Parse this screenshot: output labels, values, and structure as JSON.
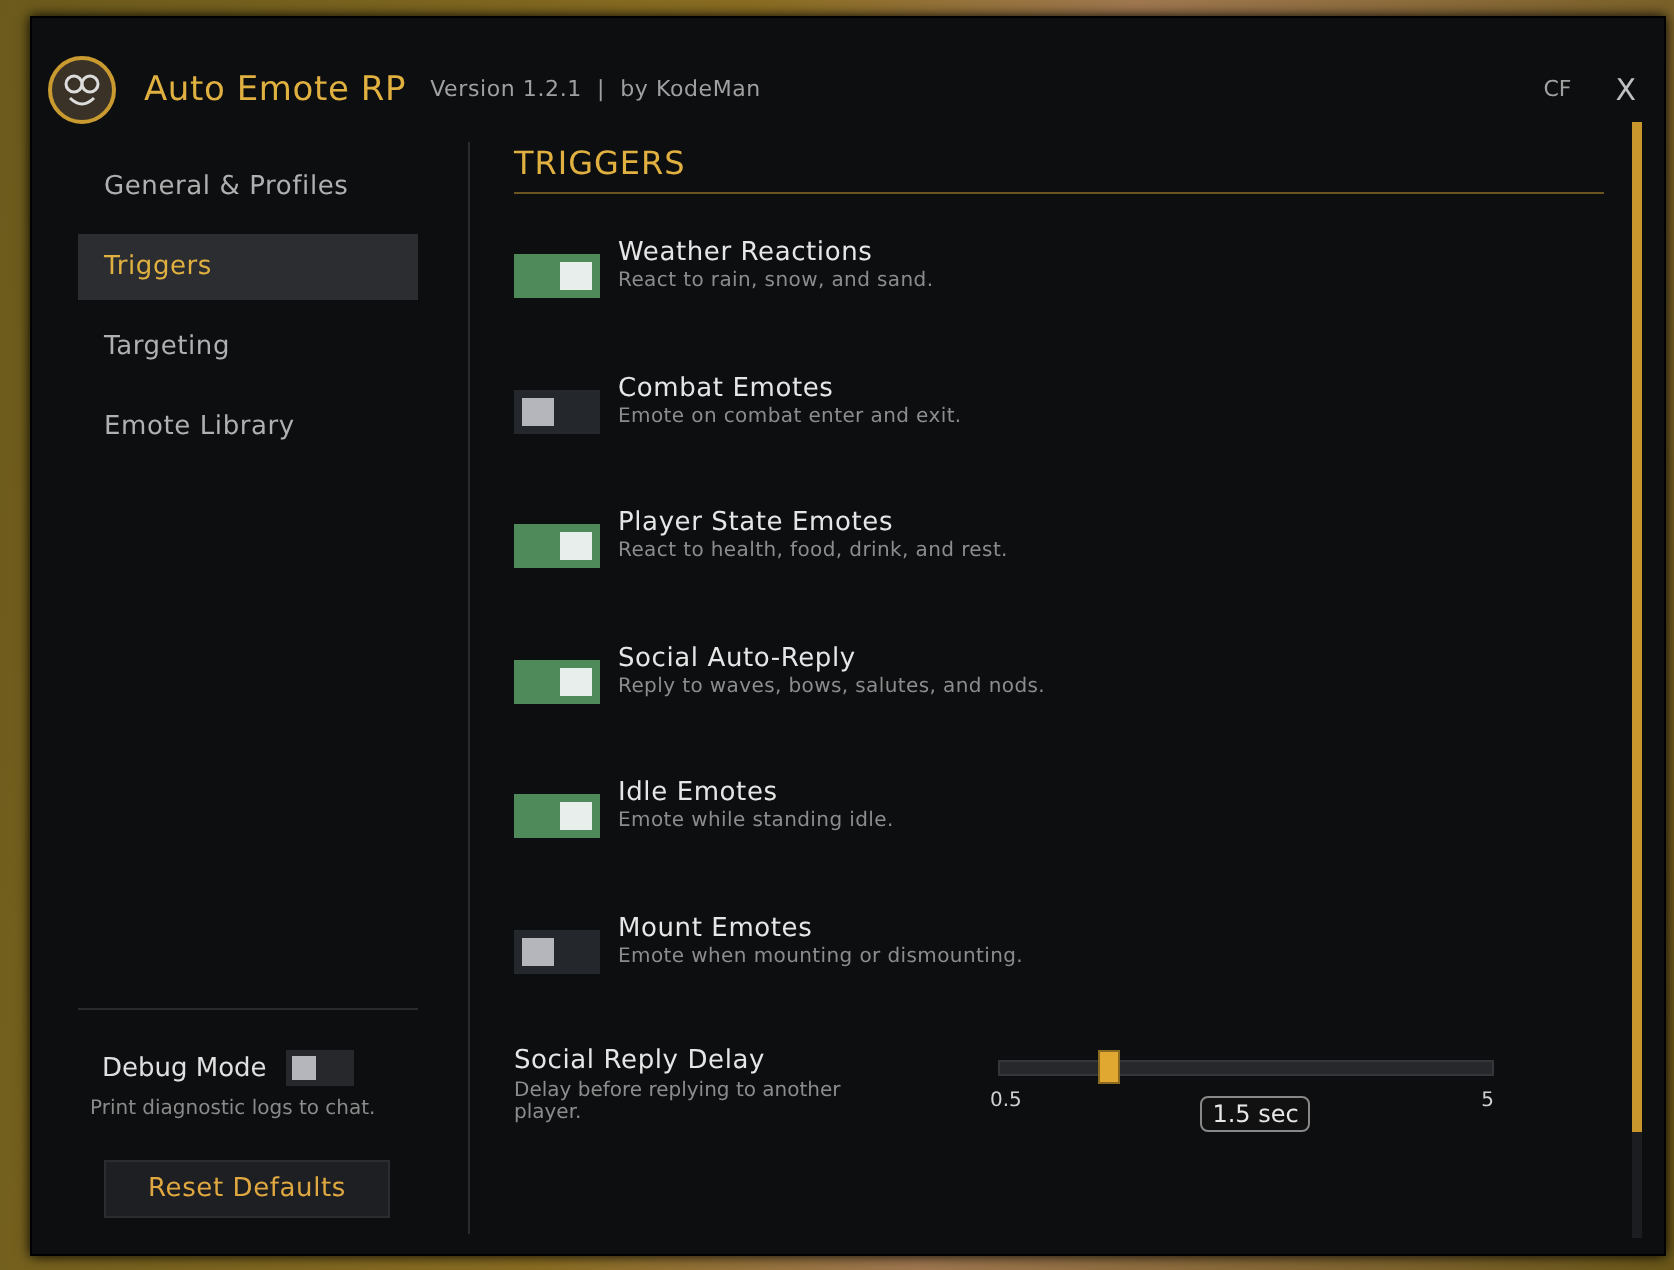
{
  "window": {
    "title": "Auto Emote RP",
    "subtitle": "Version 1.2.1  |  by KodeMan",
    "header_buttons": [
      "CF",
      "X"
    ]
  },
  "sidebar": {
    "items": [
      {
        "label": "General & Profiles",
        "selected": false
      },
      {
        "label": "Triggers",
        "selected": true
      },
      {
        "label": "Targeting",
        "selected": false
      },
      {
        "label": "Emote Library",
        "selected": false
      }
    ],
    "debug": {
      "label": "Debug Mode",
      "on": false,
      "description": "Print diagnostic logs to chat."
    },
    "reset_button": "Reset Defaults"
  },
  "content": {
    "heading": "TRIGGERS",
    "triggers": [
      {
        "title": "Weather Reactions",
        "description": "React to rain, snow, and sand.",
        "on": true
      },
      {
        "title": "Combat Emotes",
        "description": "Emote on combat enter and exit.",
        "on": false
      },
      {
        "title": "Player State Emotes",
        "description": "React to health, food, drink, and rest.",
        "on": true
      },
      {
        "title": "Social Auto-Reply",
        "description": "Reply to waves, bows, salutes, and nods.",
        "on": true
      },
      {
        "title": "Idle Emotes",
        "description": "Emote while standing idle.",
        "on": true
      },
      {
        "title": "Mount Emotes",
        "description": "Emote when mounting or dismounting.",
        "on": false
      }
    ],
    "slider": {
      "title": "Social Reply Delay",
      "description": "Delay before replying to another player.",
      "min": "0.5",
      "max": "5",
      "level": 0.22,
      "reading": "1.5 sec"
    }
  }
}
